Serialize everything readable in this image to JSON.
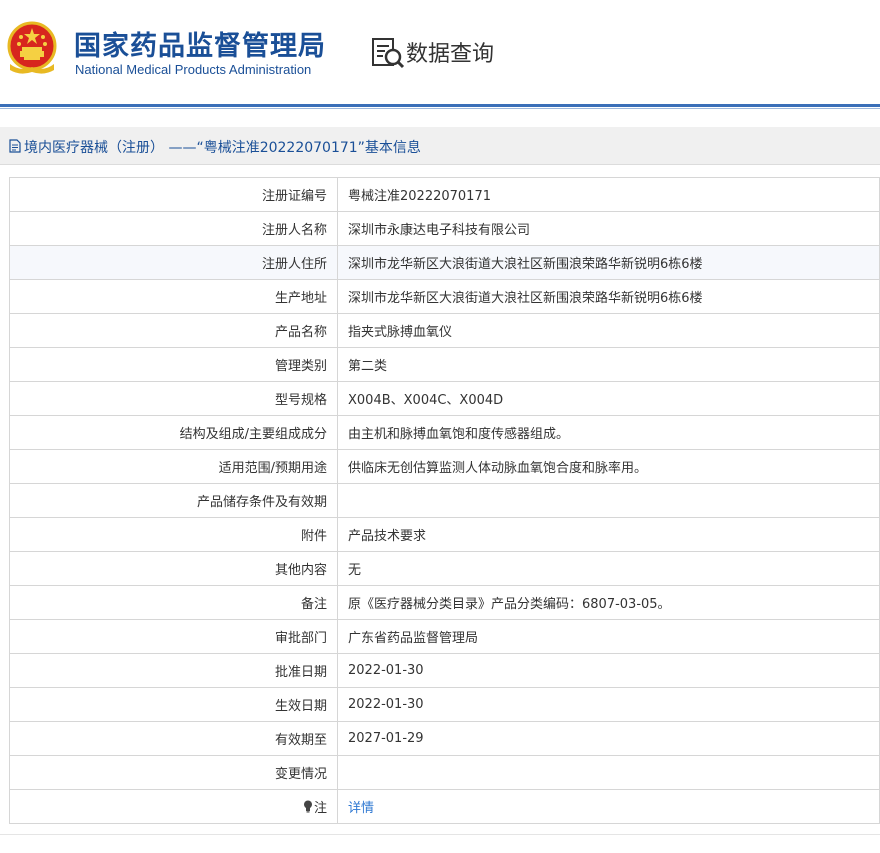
{
  "header": {
    "site_title_cn": "国家药品监督管理局",
    "site_title_en": "National Medical Products Administration",
    "query_label": "数据查询",
    "emblem_icon": "national-emblem-icon",
    "query_icon": "document-search-icon",
    "colors": {
      "brand": "#1a4f97",
      "divider": "#3a6fb8",
      "link": "#2f78d2"
    }
  },
  "title_bar": {
    "text": "境内医疗器械（注册） ——“粤械注准20222070171”基本信息",
    "icon": "document-icon"
  },
  "records": [
    {
      "label": "注册证编号",
      "value": "粤械注准20222070171"
    },
    {
      "label": "注册人名称",
      "value": "深圳市永康达电子科技有限公司"
    },
    {
      "label": "注册人住所",
      "value": "深圳市龙华新区大浪街道大浪社区新围浪荣路华新锐明6栋6楼"
    },
    {
      "label": "生产地址",
      "value": "深圳市龙华新区大浪街道大浪社区新围浪荣路华新锐明6栋6楼"
    },
    {
      "label": "产品名称",
      "value": "指夹式脉搏血氧仪"
    },
    {
      "label": "管理类别",
      "value": "第二类"
    },
    {
      "label": "型号规格",
      "value": "X004B、X004C、X004D"
    },
    {
      "label": "结构及组成/主要组成成分",
      "value": "由主机和脉搏血氧饱和度传感器组成。"
    },
    {
      "label": "适用范围/预期用途",
      "value": "供临床无创估算监测人体动脉血氧饱合度和脉率用。"
    },
    {
      "label": "产品储存条件及有效期",
      "value": ""
    },
    {
      "label": "附件",
      "value": "产品技术要求"
    },
    {
      "label": "其他内容",
      "value": "无"
    },
    {
      "label": "备注",
      "value": "原《医疗器械分类目录》产品分类编码：6807-03-05。"
    },
    {
      "label": "审批部门",
      "value": "广东省药品监督管理局"
    },
    {
      "label": "批准日期",
      "value": "2022-01-30"
    },
    {
      "label": "生效日期",
      "value": "2022-01-30"
    },
    {
      "label": "有效期至",
      "value": "2027-01-29"
    },
    {
      "label": "变更情况",
      "value": ""
    }
  ],
  "note_row": {
    "label": "注",
    "icon": "lightbulb-icon",
    "link_text": "详情"
  }
}
